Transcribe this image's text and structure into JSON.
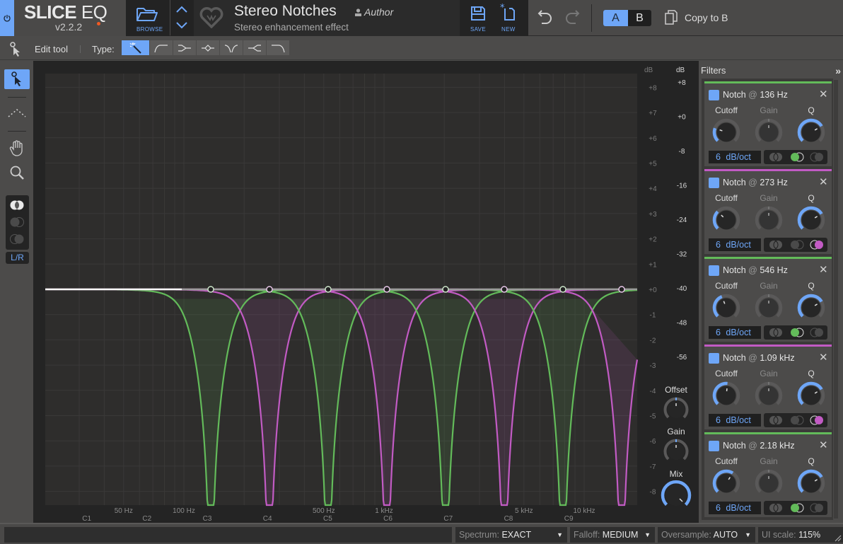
{
  "app": {
    "name_bold": "SLICE",
    "name_light": "EQ",
    "version": "v2.2.2",
    "update_dot_color": "#f25a23",
    "accent_color": "#6ea6f7"
  },
  "header": {
    "browse_label": "BROWSE",
    "preset_name": "Stereo Notches",
    "preset_author": "Author",
    "preset_description": "Stereo enhancement effect",
    "save_label": "SAVE",
    "new_label": "NEW",
    "ab": {
      "a_label": "A",
      "b_label": "B",
      "active": "A"
    },
    "copy_label": "Copy to B"
  },
  "toolbar": {
    "edit_tool_label": "Edit tool",
    "type_label": "Type:",
    "type_buttons": [
      {
        "name": "auto",
        "icon": "magic-wand-icon",
        "active": true
      },
      {
        "name": "low-cut",
        "icon": "low-cut-icon",
        "active": false
      },
      {
        "name": "low-shelf",
        "icon": "low-shelf-icon",
        "active": false
      },
      {
        "name": "bell",
        "icon": "bell-icon",
        "active": false
      },
      {
        "name": "notch",
        "icon": "notch-icon",
        "active": false
      },
      {
        "name": "high-shelf",
        "icon": "high-shelf-icon",
        "active": false
      },
      {
        "name": "high-cut",
        "icon": "high-cut-icon",
        "active": false
      }
    ]
  },
  "leftbar": {
    "tools": [
      "pointer-tool",
      "draw-tool",
      "pan-tool",
      "zoom-tool"
    ],
    "active_tool": "pointer-tool",
    "stereo_modes": [
      "stereo",
      "mid",
      "side"
    ],
    "lr_label": "L/R"
  },
  "graph": {
    "inner_db_header": "dB",
    "outer_db_header": "dB",
    "inner_db_ticks": [
      "+8",
      "+7",
      "+6",
      "+5",
      "+4",
      "+3",
      "+2",
      "+1",
      "+0",
      "-1",
      "-2",
      "-3",
      "-4",
      "-5",
      "-6",
      "-7",
      "-8"
    ],
    "outer_db_ticks": [
      "+8",
      "+0",
      "-8",
      "-16",
      "-24",
      "-32",
      "-40",
      "-48",
      "-56"
    ],
    "freq_labels": [
      "50 Hz",
      "100 Hz",
      "500 Hz",
      "1 kHz",
      "5 kHz",
      "10 kHz"
    ],
    "note_labels": [
      "C1",
      "C2",
      "C3",
      "C4",
      "C5",
      "C6",
      "C7",
      "C8",
      "C9"
    ],
    "curve_colors": {
      "green": "#63bb5a",
      "magenta": "#c25bc4",
      "master": "#ffffff"
    },
    "nodes": [
      {
        "freq": "136 Hz",
        "color": "green"
      },
      {
        "freq": "273 Hz",
        "color": "magenta"
      },
      {
        "freq": "546 Hz",
        "color": "green"
      },
      {
        "freq": "1.09 kHz",
        "color": "magenta"
      },
      {
        "freq": "2.18 kHz",
        "color": "green"
      },
      {
        "freq": "4.37 kHz",
        "color": "magenta"
      },
      {
        "freq": "8.73 kHz",
        "color": "green"
      },
      {
        "freq": "17.5 kHz",
        "color": "magenta"
      }
    ],
    "knobs": {
      "offset_label": "Offset",
      "gain_label": "Gain",
      "mix_label": "Mix",
      "mix_value": 1.0
    }
  },
  "filters": {
    "title": "Filters",
    "collapse_icon": "»",
    "cards": [
      {
        "type": "Notch",
        "at": "@",
        "freq": "136 Hz",
        "color": "#63bb5a",
        "cutoff_label": "Cutoff",
        "gain_label": "Gain",
        "q_label": "Q",
        "cutoff": 0.24,
        "q": 0.72,
        "slope": "6  dB/oct",
        "mode": "mid"
      },
      {
        "type": "Notch",
        "at": "@",
        "freq": "273 Hz",
        "color": "#c25bc4",
        "cutoff_label": "Cutoff",
        "gain_label": "Gain",
        "q_label": "Q",
        "cutoff": 0.33,
        "q": 0.72,
        "slope": "6  dB/oct",
        "mode": "side"
      },
      {
        "type": "Notch",
        "at": "@",
        "freq": "546 Hz",
        "color": "#63bb5a",
        "cutoff_label": "Cutoff",
        "gain_label": "Gain",
        "q_label": "Q",
        "cutoff": 0.42,
        "q": 0.72,
        "slope": "6  dB/oct",
        "mode": "mid"
      },
      {
        "type": "Notch",
        "at": "@",
        "freq": "1.09 kHz",
        "color": "#c25bc4",
        "cutoff_label": "Cutoff",
        "gain_label": "Gain",
        "q_label": "Q",
        "cutoff": 0.52,
        "q": 0.72,
        "slope": "6  dB/oct",
        "mode": "side"
      },
      {
        "type": "Notch",
        "at": "@",
        "freq": "2.18 kHz",
        "color": "#63bb5a",
        "cutoff_label": "Cutoff",
        "gain_label": "Gain",
        "q_label": "Q",
        "cutoff": 0.62,
        "q": 0.72,
        "slope": "6  dB/oct",
        "mode": "mid"
      }
    ]
  },
  "statusbar": {
    "spectrum_label": "Spectrum:",
    "spectrum_value": "EXACT",
    "falloff_label": "Falloff:",
    "falloff_value": "MEDIUM",
    "oversample_label": "Oversample:",
    "oversample_value": "AUTO",
    "uiscale_label": "UI scale:",
    "uiscale_value": "115%"
  }
}
